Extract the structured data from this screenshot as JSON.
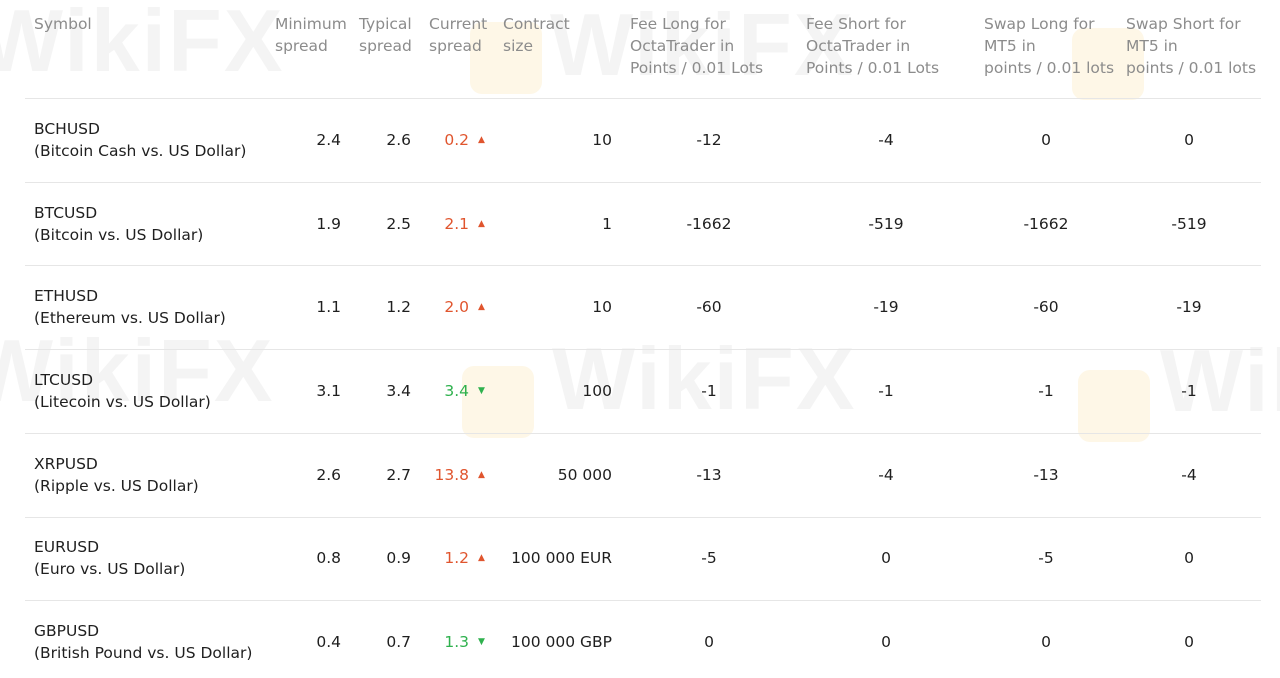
{
  "watermark": "WikiFX",
  "colors": {
    "up": "#e0552e",
    "down": "#2fb14e",
    "header": "#8c8c8c",
    "divider": "#e6e6e6"
  },
  "headers": [
    [
      "Symbol"
    ],
    [
      "Minimum",
      "spread"
    ],
    [
      "Typical",
      "spread"
    ],
    [
      "Current",
      "spread"
    ],
    [
      "Contract",
      "size"
    ],
    [
      "Fee Long for",
      "OctaTrader in",
      "Points / 0.01 Lots"
    ],
    [
      "Fee Short for",
      "OctaTrader in",
      "Points / 0.01 Lots"
    ],
    [
      "Swap Long for",
      "MT5 in",
      "points / 0.01 lots"
    ],
    [
      "Swap Short for",
      "MT5 in",
      "points / 0.01 lots"
    ]
  ],
  "rows": [
    {
      "symbol": "BCHUSD",
      "name": "(Bitcoin Cash vs. US Dollar)",
      "min": "2.4",
      "typ": "2.6",
      "cur": "0.2",
      "dir": "up",
      "size": "10",
      "fee_long": "-12",
      "fee_short": "-4",
      "swap_long": "0",
      "swap_short": "0"
    },
    {
      "symbol": "BTCUSD",
      "name": "(Bitcoin vs. US Dollar)",
      "min": "1.9",
      "typ": "2.5",
      "cur": "2.1",
      "dir": "up",
      "size": "1",
      "fee_long": "-1662",
      "fee_short": "-519",
      "swap_long": "-1662",
      "swap_short": "-519"
    },
    {
      "symbol": "ETHUSD",
      "name": "(Ethereum vs. US Dollar)",
      "min": "1.1",
      "typ": "1.2",
      "cur": "2.0",
      "dir": "up",
      "size": "10",
      "fee_long": "-60",
      "fee_short": "-19",
      "swap_long": "-60",
      "swap_short": "-19"
    },
    {
      "symbol": "LTCUSD",
      "name": "(Litecoin vs. US Dollar)",
      "min": "3.1",
      "typ": "3.4",
      "cur": "3.4",
      "dir": "down",
      "size": "100",
      "fee_long": "-1",
      "fee_short": "-1",
      "swap_long": "-1",
      "swap_short": "-1"
    },
    {
      "symbol": "XRPUSD",
      "name": "(Ripple vs. US Dollar)",
      "min": "2.6",
      "typ": "2.7",
      "cur": "13.8",
      "dir": "up",
      "size": "50 000",
      "fee_long": "-13",
      "fee_short": "-4",
      "swap_long": "-13",
      "swap_short": "-4"
    },
    {
      "symbol": "EURUSD",
      "name": "(Euro vs. US Dollar)",
      "min": "0.8",
      "typ": "0.9",
      "cur": "1.2",
      "dir": "up",
      "size": "100 000 EUR",
      "fee_long": "-5",
      "fee_short": "0",
      "swap_long": "-5",
      "swap_short": "0"
    },
    {
      "symbol": "GBPUSD",
      "name": "(British Pound vs. US Dollar)",
      "min": "0.4",
      "typ": "0.7",
      "cur": "1.3",
      "dir": "down",
      "size": "100 000 GBP",
      "fee_long": "0",
      "fee_short": "0",
      "swap_long": "0",
      "swap_short": "0"
    }
  ]
}
